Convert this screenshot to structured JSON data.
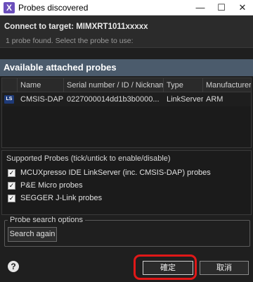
{
  "window": {
    "icon_text": "X",
    "title": "Probes discovered",
    "min_glyph": "—",
    "max_glyph": "☐",
    "close_glyph": "✕"
  },
  "header": {
    "connect_text": "Connect to target: MIMXRT1011xxxxx",
    "found_text": "1 probe found. Select the probe to use:"
  },
  "available": {
    "title": "Available attached probes",
    "columns": [
      "",
      "Name",
      "Serial number / ID / Nicknam",
      "Type",
      "Manufacturer"
    ],
    "rows": [
      {
        "icon_text": "LS",
        "name": "CMSIS-DAP",
        "serial": "0227000014dd1b3b0000...",
        "type": "LinkServer",
        "manufacturer": "ARM"
      }
    ]
  },
  "supported": {
    "title": "Supported Probes (tick/untick to enable/disable)",
    "items": [
      {
        "label": "MCUXpresso IDE LinkServer (inc. CMSIS-DAP) probes",
        "checked": true,
        "mark": "✓"
      },
      {
        "label": "P&E Micro probes",
        "checked": true,
        "mark": "✓"
      },
      {
        "label": "SEGGER J-Link probes",
        "checked": true,
        "mark": "✓"
      }
    ]
  },
  "search": {
    "legend": "Probe search options",
    "button_label": "Search again"
  },
  "footer": {
    "help_glyph": "?",
    "ok_label": "確定",
    "cancel_label": "取消"
  },
  "colors": {
    "section_header_bg": "#4b5b6c",
    "highlight_ring": "#e01818",
    "dialog_bg": "#1f1f1f"
  }
}
